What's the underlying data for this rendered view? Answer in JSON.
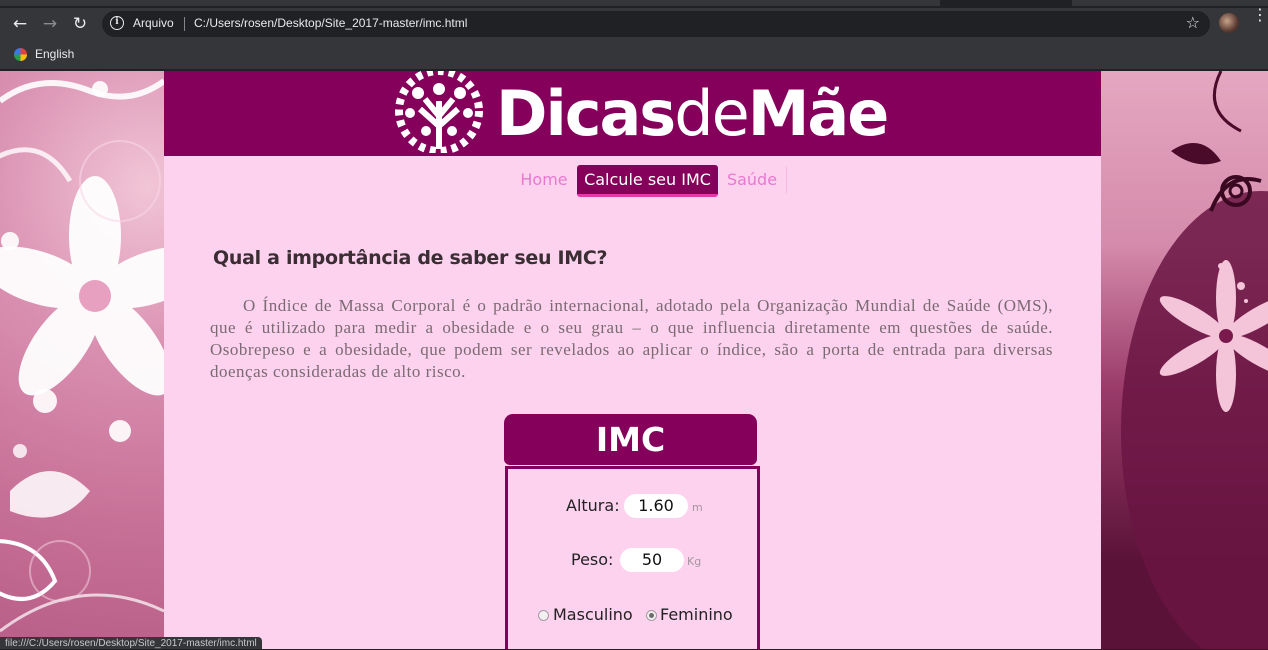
{
  "browser": {
    "back_icon": "arrow-left-icon",
    "forward_icon": "arrow-right-icon",
    "reload_icon": "reload-icon",
    "security_label": "Arquivo",
    "url": "C:/Users/rosen/Desktop/Site_2017-master/imc.html",
    "bookmark_label": "English",
    "status_url": "file:///C:/Users/rosen/Desktop/Site_2017-master/imc.html"
  },
  "site": {
    "logo": {
      "part1": "Dicas",
      "part2": "de",
      "part3": "Mãe"
    },
    "nav": [
      {
        "label": "Home",
        "active": false
      },
      {
        "label": "Calcule seu IMC",
        "active": true
      },
      {
        "label": "Saúde",
        "active": false
      }
    ],
    "heading": "Qual a importância de saber seu IMC?",
    "paragraph": "O Índice de Massa Corporal é o padrão internacional, adotado pela Organização Mundial de Saúde (OMS), que é utilizado para medir a obesidade e o seu grau – o que influencia diretamente em questões de saúde. Osobrepeso e a obesidade, que podem ser revelados ao aplicar o índice, são a porta de entrada para diversas doenças consideradas de alto risco.",
    "imc": {
      "title": "IMC",
      "height_label": "Altura:",
      "height_value": "1.60",
      "height_unit": "m",
      "weight_label": "Peso:",
      "weight_value": "50",
      "weight_unit": "Kg",
      "sex_options": [
        "Masculino",
        "Feminino"
      ],
      "sex_selected": "Feminino"
    }
  },
  "colors": {
    "brand": "#85005a",
    "page_bg": "#fdd2ee",
    "nav_link": "#e67ad0"
  }
}
